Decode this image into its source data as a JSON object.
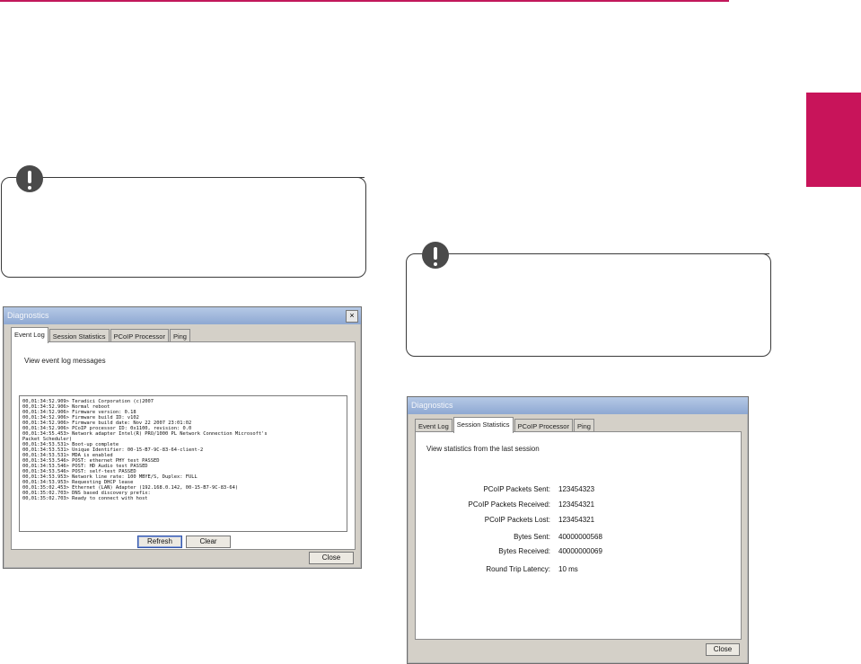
{
  "event_dialog": {
    "title": "Diagnostics",
    "close_glyph": "×",
    "tabs": [
      "Event Log",
      "Session Statistics",
      "PCoIP Processor",
      "Ping"
    ],
    "caption": "View event log messages",
    "log_lines": [
      "00,01:34:52.909> Teradici Corporation (c)2007",
      "00,01:34:52.906> Normal reboot",
      "00,01:34:52.906> Firmware version: 0.18",
      "00,01:34:52.906> Firmware build ID: v102",
      "00,01:34:52.906> Firmware build date: Nov 22 2007 23:01:02",
      "00,01:34:52.906> PCoIP processor ID: 0x1100, revision: 0.0",
      "00,01:34:55.453> Network adapter Intel(R) PRO/1000 PL Network Connection Microsoft's",
      "Packet Scheduler)",
      "00,01:34:53.531> Boot-up complete",
      "00,01:34:53.531> Unique Identifier: 00-15-B7-9C-83-64-client-2",
      "00,01:34:53.531> MDA is enabled",
      "00,01:34:53.546> POST: ethernet PHY test PASSED",
      "00,01:34:53.546> POST: HD Audio test PASSED",
      "00,01:34:53.546> POST: self-test PASSED",
      "00,01:34:53.953> Network line rate: 100 MBYE/S, Duplex: FULL",
      "00,01:34:53.953> Requesting DHCP lease",
      "00,01:35:02.453> Ethernet (LAN) Adapter (192.168.0.142, 00-15-B7-9C-83-64)",
      "00,01:35:02.703> DNS based discovery prefix:",
      "00,01:35:02.703> Ready to connect with host"
    ],
    "refresh_label": "Refresh",
    "clear_label": "Clear",
    "close_label": "Close"
  },
  "stats_dialog": {
    "title": "Diagnostics",
    "close_glyph": "",
    "tabs": [
      "Event Log",
      "Session Statistics",
      "PCoIP Processor",
      "Ping"
    ],
    "caption": "View statistics from the last session",
    "stats": [
      {
        "label": "PCoIP Packets Sent:",
        "value": "123454323"
      },
      {
        "label": "PCoIP Packets Received:",
        "value": "123454321"
      },
      {
        "label": "PCoIP Packets Lost:",
        "value": "123454321"
      },
      {
        "label": "Bytes Sent:",
        "value": "40000000568"
      },
      {
        "label": "Bytes Received:",
        "value": "40000000069"
      },
      {
        "label": "Round Trip Latency:",
        "value": "10 ms"
      }
    ],
    "close_label": "Close"
  },
  "colors": {
    "accent": "#c8145a",
    "rule": "#c1185b"
  }
}
